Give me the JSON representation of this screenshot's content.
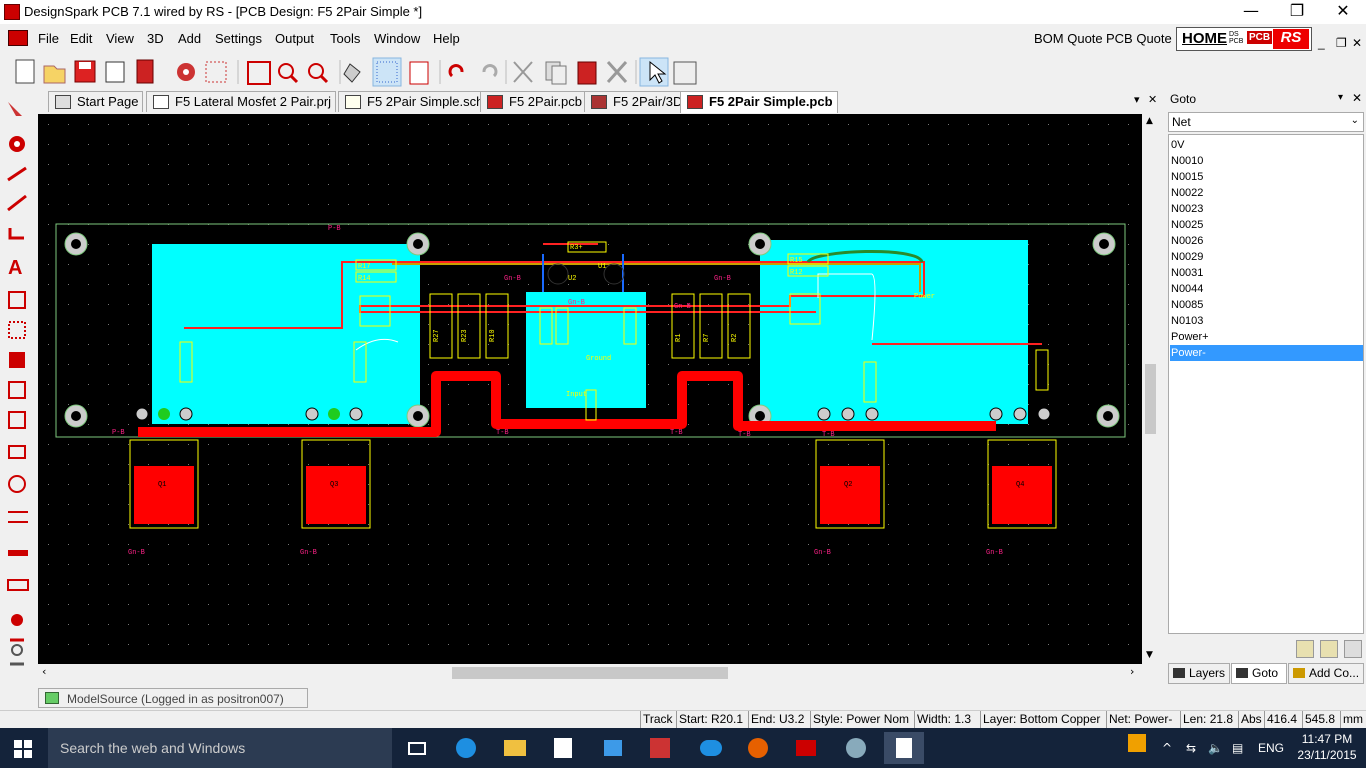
{
  "window": {
    "title": "DesignSpark PCB 7.1 wired by RS - [PCB Design: F5 2Pair Simple *]",
    "minimize": "—",
    "restore": "❐",
    "close": "✕"
  },
  "menu": {
    "items": [
      "File",
      "Edit",
      "View",
      "3D",
      "Add",
      "Settings",
      "Output",
      "Tools",
      "Window",
      "Help"
    ],
    "bom_quote": "BOM Quote",
    "pcb_quote": "PCB Quote",
    "home": "HOME",
    "home_ds_text": "DS PCB",
    "pcb_badge": "PCB",
    "rs_logo": "RS",
    "mdi_min": "_",
    "mdi_restore": "❐",
    "mdi_close": "✕"
  },
  "tabs": [
    {
      "label": "Start Page",
      "icon": "start-page-icon",
      "active": false
    },
    {
      "label": "F5 Lateral Mosfet 2 Pair.prj",
      "icon": "project-icon",
      "active": false
    },
    {
      "label": "F5 2Pair Simple.sch",
      "icon": "schematic-icon",
      "active": false
    },
    {
      "label": "F5 2Pair.pcb",
      "icon": "pcb-icon",
      "active": false
    },
    {
      "label": "F5 2Pair/3D",
      "icon": "3d-icon",
      "active": false
    },
    {
      "label": "F5 2Pair Simple.pcb",
      "icon": "pcb-icon",
      "active": true
    }
  ],
  "goto_panel": {
    "title": "Goto",
    "filter": "Net",
    "nets": [
      "0V",
      "N0010",
      "N0015",
      "N0022",
      "N0023",
      "N0025",
      "N0026",
      "N0029",
      "N0031",
      "N0044",
      "N0085",
      "N0103",
      "Power+",
      "Power-"
    ],
    "selected": "Power-",
    "tabs": [
      "Layers",
      "Goto",
      "Add Co..."
    ]
  },
  "pcb": {
    "components": [
      "R17",
      "R14",
      "R15",
      "R12",
      "R27",
      "R23",
      "R10",
      "R1",
      "R7",
      "R2",
      "R3",
      "R9",
      "R24",
      "U1",
      "U2",
      "Q1",
      "Q2",
      "Q3",
      "Q4"
    ],
    "labels": [
      "P-B",
      "T-B",
      "Gn-B",
      "Power",
      "Ground",
      "Input"
    ],
    "colors": {
      "board_outline": "#7ec87e",
      "copper_area": "#00ffff",
      "bottom_copper": "#ff0000",
      "silkscreen": "#ffff00",
      "background": "#000000"
    }
  },
  "modelsource": "ModelSource (Logged in as positron007)",
  "status": {
    "mode": "Track",
    "start": "Start: R20.1",
    "end": "End: U3.2",
    "style": "Style: Power Nom",
    "width": "Width: 1.3",
    "layer": "Layer: Bottom Copper",
    "net": "Net: Power-",
    "len": "Len: 21.8",
    "abs": "Abs",
    "x": "416.4",
    "y": "545.8",
    "units": "mm"
  },
  "taskbar": {
    "search": "Search the web and Windows",
    "lang": "ENG",
    "time": "11:47 PM",
    "date": "23/11/2015"
  }
}
